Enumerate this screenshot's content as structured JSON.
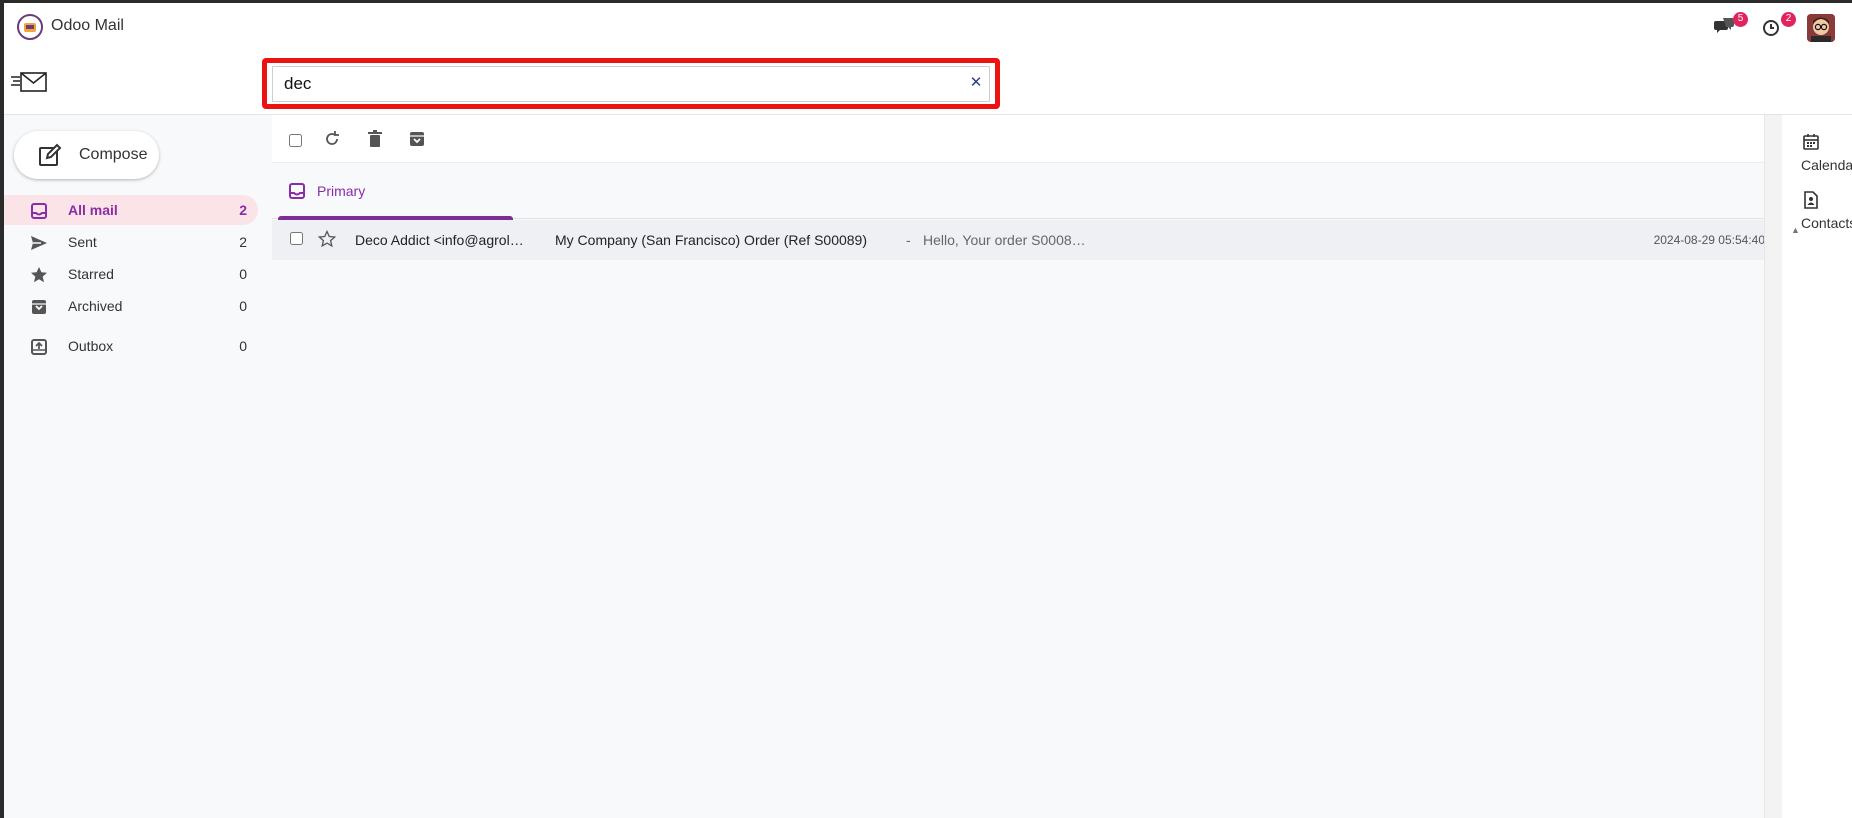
{
  "app": {
    "title": "Odoo Mail"
  },
  "systray": {
    "messages": {
      "icon": "chat-bubbles-icon",
      "count": "5"
    },
    "activities": {
      "icon": "clock-icon",
      "count": "2"
    }
  },
  "search": {
    "value": "dec",
    "clear_icon": "close-icon"
  },
  "compose": {
    "label": "Compose"
  },
  "nav": [
    {
      "label": "All mail",
      "count": "2",
      "icon": "inbox-icon",
      "active": true
    },
    {
      "label": "Sent",
      "count": "2",
      "icon": "send-icon"
    },
    {
      "label": "Starred",
      "count": "0",
      "icon": "star-icon"
    },
    {
      "label": "Archived",
      "count": "0",
      "icon": "archive-icon"
    },
    {
      "label": "Outbox",
      "count": "0",
      "icon": "outbox-icon"
    }
  ],
  "tabs": [
    {
      "label": "Primary",
      "icon": "inbox-icon"
    }
  ],
  "mails": [
    {
      "sender": "Deco Addict <info@agrol…",
      "subject": "My Company (San Francisco) Order (Ref S00089)",
      "separator": "-",
      "preview": "Hello, Your order S0008…",
      "date": "2024-08-29 05:54:40"
    }
  ],
  "rail": [
    {
      "label": "Calendar",
      "icon": "calendar-icon"
    },
    {
      "label": "Contacts",
      "icon": "contact-icon"
    }
  ],
  "colors": {
    "accent": "#8a2ca6",
    "active_bg": "#fbe4e8",
    "search_outline": "#ee1111",
    "badge": "#e0245e"
  }
}
